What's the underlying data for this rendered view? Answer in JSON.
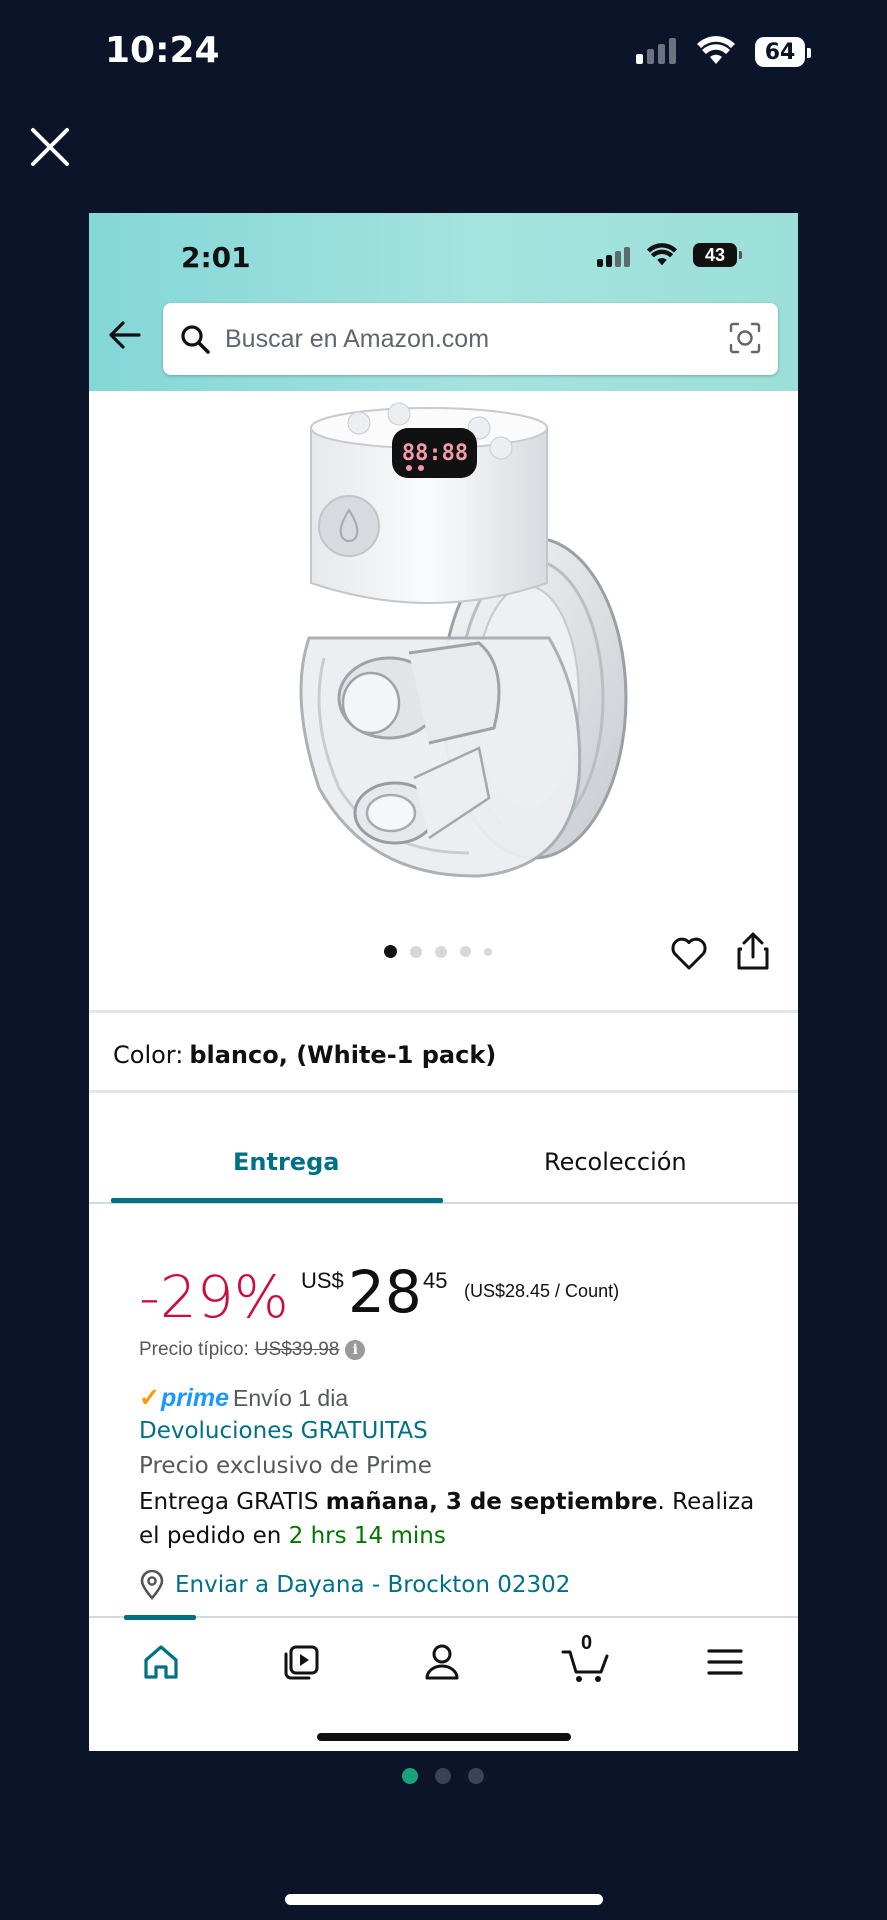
{
  "outer_status": {
    "time": "10:24",
    "battery": "64"
  },
  "viewer": {
    "close_icon": "close-icon",
    "page_count": 3,
    "active_page": 1
  },
  "app": {
    "status": {
      "time": "2:01",
      "battery": "43"
    },
    "search": {
      "placeholder": "Buscar en Amazon.com"
    },
    "carousel": {
      "count": 5,
      "active": 1
    },
    "color": {
      "label": "Color:",
      "value": "blanco, (White-1 pack)"
    },
    "tabs": [
      {
        "label": "Entrega",
        "active": true
      },
      {
        "label": "Recolección",
        "active": false
      }
    ],
    "price": {
      "discount": "-29%",
      "currency": "US$",
      "whole": "28",
      "fraction": "45",
      "unit_price": "(US$28.45 / Count)",
      "typical_label": "Precio típico:",
      "typical_value": "US$39.98"
    },
    "prime": {
      "logo": "prime",
      "shipping": "Envío 1 dia"
    },
    "returns": "Devoluciones GRATUITAS",
    "exclusive": "Precio exclusivo de Prime",
    "delivery": {
      "prefix": "Entrega GRATIS ",
      "date": "mañana, 3 de septiembre",
      "mid": ". Realiza el pedido en ",
      "countdown": "2 hrs 14 mins"
    },
    "location": "Enviar a Dayana - Brockton 02302",
    "nav": {
      "cart_count": "0",
      "items": [
        "home-icon",
        "video-icon",
        "account-icon",
        "cart-icon",
        "menu-icon"
      ]
    }
  },
  "colors": {
    "accent_teal": "#007185",
    "discount_red": "#cc0c39",
    "prime_blue": "#1a98ff",
    "countdown_green": "#007600"
  }
}
